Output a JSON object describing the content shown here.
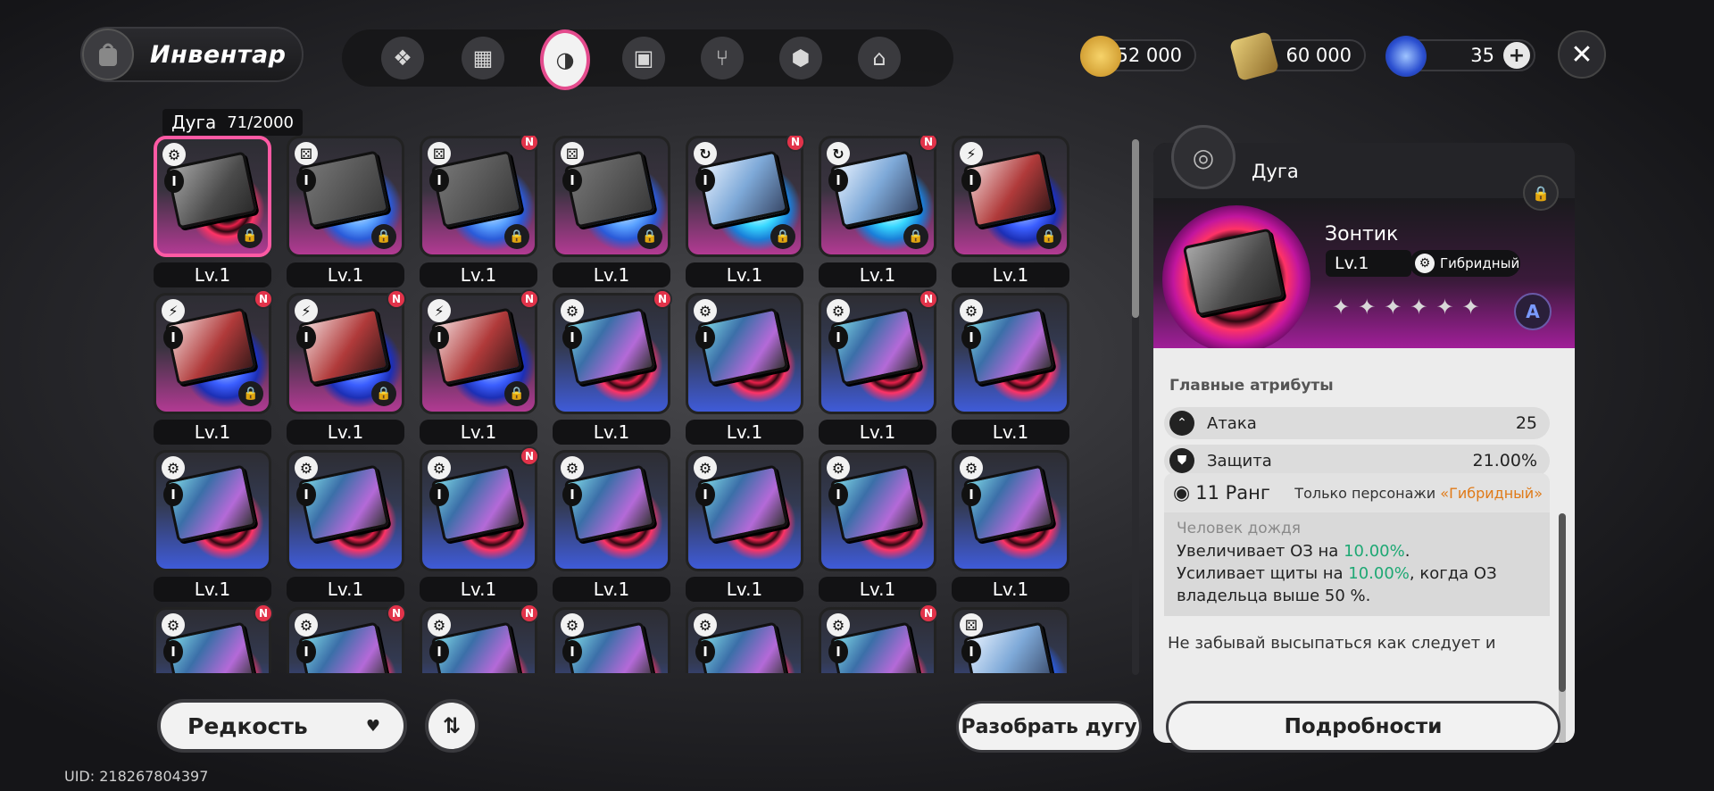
{
  "header": {
    "title": "Инвентар",
    "tabs": [
      {
        "icon": "n-shape-icon",
        "glyph": "❖"
      },
      {
        "icon": "device-icon",
        "glyph": "▦"
      },
      {
        "icon": "arc-disc-icon",
        "glyph": "◑",
        "active": true
      },
      {
        "icon": "cube-icon",
        "glyph": "▣"
      },
      {
        "icon": "fork-knife-icon",
        "glyph": "⑂"
      },
      {
        "icon": "package-icon",
        "glyph": "⬢"
      },
      {
        "icon": "home-icon",
        "glyph": "⌂"
      }
    ],
    "currencies": [
      {
        "name": "gold-coin-icon",
        "value": "152 000",
        "color": "#d8a93a"
      },
      {
        "name": "ticket-icon",
        "value": "60 000",
        "color": "#c9a24a"
      },
      {
        "name": "crystal-icon",
        "value": "35",
        "color": "#3b6ad8",
        "has_plus": true
      }
    ],
    "close_glyph": "✕"
  },
  "list": {
    "category": "Дуга",
    "count": "71/2000",
    "level_label": "Lv.1",
    "rank_label": "I",
    "lock_glyph": "🔒",
    "new_label": "N",
    "rows": [
      [
        {
          "type": "gear",
          "bg": "pink",
          "orb": "red",
          "art": "rain",
          "new": false,
          "locked": true,
          "selected": true
        },
        {
          "type": "d6",
          "bg": "pink",
          "orb": "ice",
          "art": "grey",
          "new": false,
          "locked": true
        },
        {
          "type": "d6",
          "bg": "pink",
          "orb": "ice",
          "art": "grey",
          "new": true,
          "locked": true
        },
        {
          "type": "d6",
          "bg": "pink",
          "orb": "ice",
          "art": "grey",
          "new": false,
          "locked": true
        },
        {
          "type": "swirl",
          "bg": "pink",
          "orb": "cyan",
          "art": "ice",
          "new": true,
          "locked": true
        },
        {
          "type": "swirl",
          "bg": "pink",
          "orb": "cyan",
          "art": "ice",
          "new": true,
          "locked": true
        },
        {
          "type": "bolt",
          "bg": "pink",
          "orb": "volt",
          "art": "red",
          "new": false,
          "locked": true
        }
      ],
      [
        {
          "type": "bolt",
          "bg": "pink",
          "orb": "volt",
          "art": "red",
          "new": true,
          "locked": true
        },
        {
          "type": "bolt",
          "bg": "pink",
          "orb": "volt",
          "art": "red",
          "new": true,
          "locked": true
        },
        {
          "type": "bolt",
          "bg": "pink",
          "orb": "volt",
          "art": "red",
          "new": true,
          "locked": true
        },
        {
          "type": "gear",
          "bg": "blue",
          "orb": "red",
          "art": "holo",
          "new": true,
          "locked": false
        },
        {
          "type": "gear",
          "bg": "blue",
          "orb": "red",
          "art": "holo",
          "new": false,
          "locked": false
        },
        {
          "type": "gear",
          "bg": "blue",
          "orb": "red",
          "art": "holo",
          "new": true,
          "locked": false
        },
        {
          "type": "gear",
          "bg": "blue",
          "orb": "red",
          "art": "holo",
          "new": false,
          "locked": false
        }
      ],
      [
        {
          "type": "gear",
          "bg": "blue",
          "orb": "red",
          "art": "holo",
          "new": false,
          "locked": false
        },
        {
          "type": "gear",
          "bg": "blue",
          "orb": "red",
          "art": "holo",
          "new": false,
          "locked": false
        },
        {
          "type": "gear",
          "bg": "blue",
          "orb": "red",
          "art": "holo",
          "new": true,
          "locked": false
        },
        {
          "type": "gear",
          "bg": "blue",
          "orb": "red",
          "art": "holo",
          "new": false,
          "locked": false
        },
        {
          "type": "gear",
          "bg": "blue",
          "orb": "red",
          "art": "holo",
          "new": false,
          "locked": false
        },
        {
          "type": "gear",
          "bg": "blue",
          "orb": "red",
          "art": "holo",
          "new": false,
          "locked": false
        },
        {
          "type": "gear",
          "bg": "blue",
          "orb": "red",
          "art": "holo",
          "new": false,
          "locked": false
        }
      ],
      [
        {
          "type": "gear",
          "bg": "blue",
          "orb": "red",
          "art": "holo",
          "new": true,
          "locked": false
        },
        {
          "type": "gear",
          "bg": "blue",
          "orb": "red",
          "art": "holo",
          "new": true,
          "locked": false
        },
        {
          "type": "gear",
          "bg": "blue",
          "orb": "red",
          "art": "holo",
          "new": true,
          "locked": false
        },
        {
          "type": "gear",
          "bg": "blue",
          "orb": "red",
          "art": "holo",
          "new": false,
          "locked": false
        },
        {
          "type": "gear",
          "bg": "blue",
          "orb": "red",
          "art": "holo",
          "new": false,
          "locked": false
        },
        {
          "type": "gear",
          "bg": "blue",
          "orb": "red",
          "art": "holo",
          "new": true,
          "locked": false
        },
        {
          "type": "d6",
          "bg": "blue",
          "orb": "ice",
          "art": "ice",
          "new": false,
          "locked": false
        }
      ]
    ]
  },
  "controls": {
    "sort_label": "Редкость",
    "sort_chevron": "♥",
    "order_glyph": "⇅",
    "disassemble_label": "Разобрать дугу",
    "uid": "UID: 218267804397"
  },
  "detail": {
    "category": "Дуга",
    "name": "Зонтик",
    "level": "Lv.1",
    "type_label": "Гибридный",
    "stars": "✦✦✦✦✦✦",
    "attr_title": "Главные атрибуты",
    "attrs": [
      {
        "label": "Атака",
        "value": "25"
      },
      {
        "label": "Защита",
        "value": "21.00%"
      }
    ],
    "rank": {
      "label": "11 Ранг",
      "only_prefix": "Только персонажи",
      "only_type": "«Гибридный»",
      "subtitle": "Человек дождя",
      "line1_a": "Увеличивает ОЗ на ",
      "line1_b": "10.00%",
      "line1_c": ".",
      "line2_a": "Усиливает щиты на ",
      "line2_b": "10.00%",
      "line2_c": ", когда ОЗ",
      "line3": "владельца выше 50 %."
    },
    "flavor": "Не забывай высыпаться как следует и",
    "details_label": "Подробности"
  }
}
